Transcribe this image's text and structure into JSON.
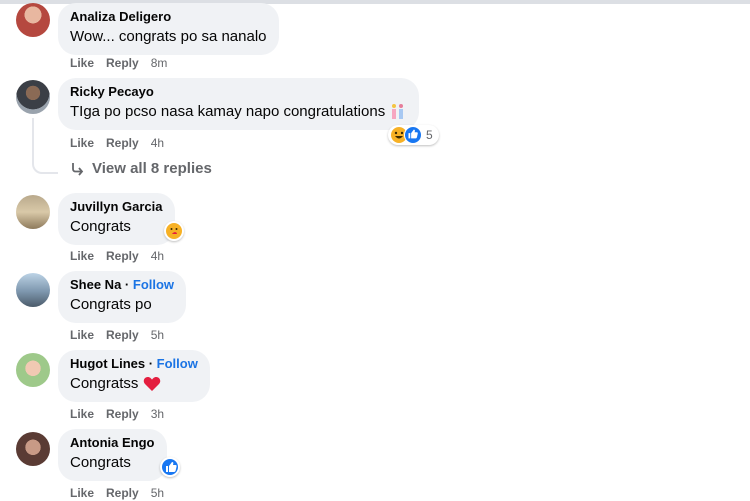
{
  "actions": {
    "like": "Like",
    "reply": "Reply"
  },
  "comments": [
    {
      "author": "Analiza Deligero",
      "follow": "",
      "text": "Wow... congrats po sa nanalo",
      "time": "8m"
    },
    {
      "author": "Ricky Pecayo",
      "follow": "",
      "text": "TIga po pcso nasa kamay napo congratulations",
      "time": "4h",
      "reaction_count": "5"
    },
    {
      "author": "Juvillyn Garcia",
      "follow": "",
      "text": "Congrats",
      "time": "4h"
    },
    {
      "author": "Shee Na",
      "follow": "Follow",
      "text": "Congrats po",
      "time": "5h"
    },
    {
      "author": "Hugot Lines",
      "follow": "Follow",
      "text": "Congratss",
      "time": "3h"
    },
    {
      "author": "Antonia Engo",
      "follow": "",
      "text": "Congrats",
      "time": "5h"
    }
  ],
  "replies": {
    "label": "View all 8 replies"
  },
  "colors": {
    "bubble": "#f0f2f5",
    "link": "#1b74e4",
    "meta": "#65676b",
    "like": "#1877f2",
    "heart": "#e41e3f"
  },
  "icons": [
    "reply-arrow-icon",
    "haha-reaction-icon",
    "like-reaction-icon",
    "care-reaction-icon",
    "heart-emoji-icon",
    "confetti-emoji-icon"
  ]
}
